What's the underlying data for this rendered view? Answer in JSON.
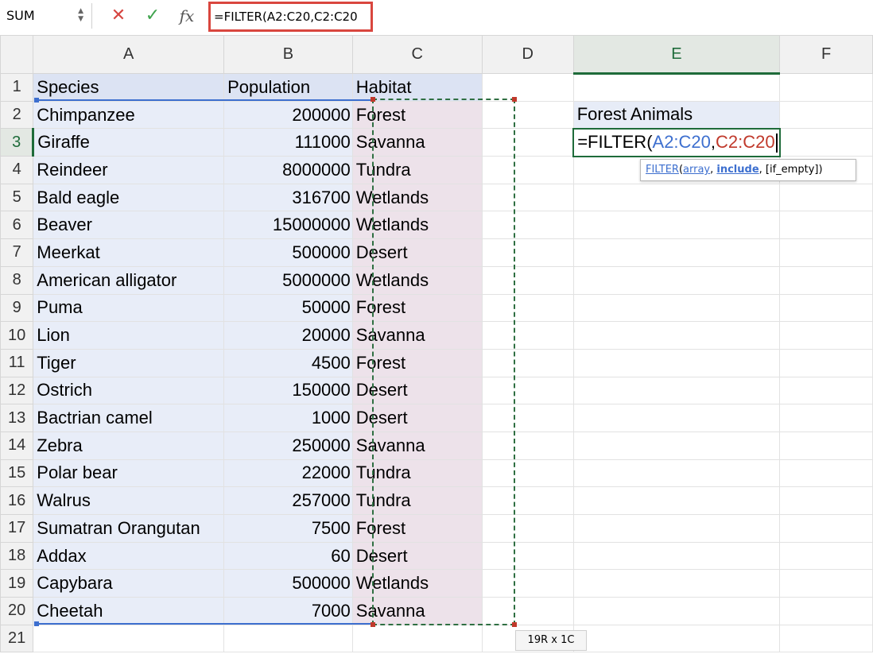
{
  "formula_bar": {
    "name_box": "SUM",
    "cancel_icon": "close-icon",
    "enter_icon": "checkmark-icon",
    "fx_label": "fx",
    "formula": "=FILTER(A2:C20,C2:C20"
  },
  "columns": [
    "A",
    "B",
    "C",
    "D",
    "E",
    "F"
  ],
  "header_row": {
    "row": "1",
    "species": "Species",
    "population": "Population",
    "habitat": "Habitat"
  },
  "rows": [
    {
      "row": "2",
      "species": "Chimpanzee",
      "population": "200000",
      "habitat": "Forest"
    },
    {
      "row": "3",
      "species": "Giraffe",
      "population": "111000",
      "habitat": "Savanna"
    },
    {
      "row": "4",
      "species": "Reindeer",
      "population": "8000000",
      "habitat": "Tundra"
    },
    {
      "row": "5",
      "species": "Bald eagle",
      "population": "316700",
      "habitat": "Wetlands"
    },
    {
      "row": "6",
      "species": "Beaver",
      "population": "15000000",
      "habitat": "Wetlands"
    },
    {
      "row": "7",
      "species": "Meerkat",
      "population": "500000",
      "habitat": "Desert"
    },
    {
      "row": "8",
      "species": "American alligator",
      "population": "5000000",
      "habitat": "Wetlands"
    },
    {
      "row": "9",
      "species": "Puma",
      "population": "50000",
      "habitat": "Forest"
    },
    {
      "row": "10",
      "species": "Lion",
      "population": "20000",
      "habitat": "Savanna"
    },
    {
      "row": "11",
      "species": "Tiger",
      "population": "4500",
      "habitat": "Forest"
    },
    {
      "row": "12",
      "species": "Ostrich",
      "population": "150000",
      "habitat": "Desert"
    },
    {
      "row": "13",
      "species": "Bactrian camel",
      "population": "1000",
      "habitat": "Desert"
    },
    {
      "row": "14",
      "species": "Zebra",
      "population": "250000",
      "habitat": "Savanna"
    },
    {
      "row": "15",
      "species": "Polar bear",
      "population": "22000",
      "habitat": "Tundra"
    },
    {
      "row": "16",
      "species": "Walrus",
      "population": "257000",
      "habitat": "Tundra"
    },
    {
      "row": "17",
      "species": "Sumatran Orangutan",
      "population": "7500",
      "habitat": "Forest"
    },
    {
      "row": "18",
      "species": "Addax",
      "population": "60",
      "habitat": "Desert"
    },
    {
      "row": "19",
      "species": "Capybara",
      "population": "500000",
      "habitat": "Wetlands"
    },
    {
      "row": "20",
      "species": "Cheetah",
      "population": "7000",
      "habitat": "Savanna"
    }
  ],
  "last_row_number": "21",
  "e2_title": "Forest Animals",
  "e3_formula": {
    "prefix": "=FILTER(",
    "arg1": "A2:C20",
    "comma": ",",
    "arg2": "C2:C20"
  },
  "tooltip": {
    "fn": "FILTER",
    "open": "(",
    "arg1": "array",
    "sep1": ", ",
    "arg2": "include",
    "sep2": ", ",
    "arg3": "[if_empty]",
    "close": ")"
  },
  "selection_size": "19R x 1C",
  "colors": {
    "range_a": "#3d6fcf",
    "range_c": "#c0392b",
    "active": "#1e6b3a",
    "highlight_border": "#d9463e"
  }
}
